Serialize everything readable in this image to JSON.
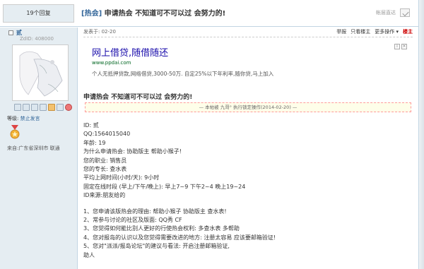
{
  "header": {
    "replies": "19个回复",
    "category": "[热会]",
    "title": "申请热会 不知道可不可以过 会努力的!",
    "right_label": "帐层直达"
  },
  "sidebar": {
    "username": "贰",
    "uid": "ZdID: 408000",
    "level_label": "等级:",
    "level_value": "禁止发言",
    "location": "来自:广东省深圳市 联通"
  },
  "post": {
    "meta": "发表于: 02-20",
    "tools": [
      "举报",
      "只看楼主",
      "更多操作",
      "楼主"
    ],
    "title": "申请热会 不知道可不可以过 会努力的!",
    "notice": "— 本帖被 九哥° 执行锁定操作(2014-02-20) —",
    "lines_a": [
      "ID: 贰",
      "QQ:1564015040",
      "年龄: 19",
      "为什么申请热会: 协助版主 帮助小猴子!",
      "您的职业: 销售员",
      "您的专长: 查水表",
      "平均上网时间(小时/天): 9小时",
      "固定在线时段 (早上/下午/晚上): 早上7~9 下午2~4 晚上19~24",
      "ID来源:朋友给的"
    ],
    "lines_b": [
      "1、您申请该版热会的理由: 帮助小猴子 协助版主 查水表!",
      "2、常参与讨论的社区及版面: QQ秀 CF",
      "3、您觉得如何能比别人更好的行使热会权利: 多查水表 多帮助",
      "4、您对报岛的认识以及您觉得需要改进的地方: 注册太容易 应该要邮箱验证!",
      "5、您对\"派派/报岛论坛\"的建议与看法: 开启注册邮箱验证,",
      "助人"
    ]
  },
  "ad": {
    "title": "网上借贷,随借随还",
    "url": "www.ppdai.com",
    "description": "个人无抵押贷款,网络借贷,3000-50万. 自定25%以下年利率,随你贷,马上加入"
  },
  "colors": {
    "sidebar_bg": "#e5edf2",
    "link": "#336699",
    "notice_border": "#ff9a9a",
    "ad_title": "#1a0dab"
  }
}
